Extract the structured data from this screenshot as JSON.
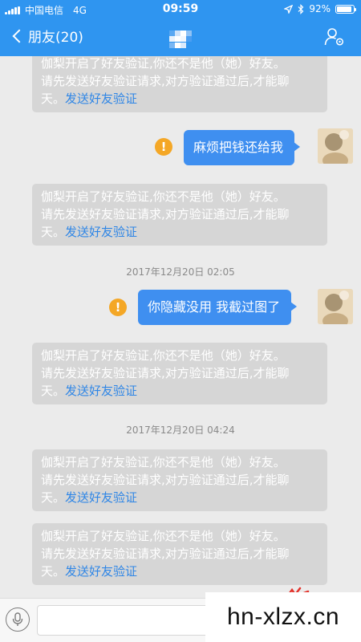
{
  "status_bar": {
    "carrier": "中国电信",
    "network": "4G",
    "time": "09:59",
    "battery": "92%",
    "battery_level": 0.92
  },
  "nav": {
    "back_label": "朋友(20)",
    "title_obscured": true,
    "profile_icon": "profile-settings-icon"
  },
  "messages": [
    {
      "type": "system",
      "text": "伽梨开启了好友验证,你还不是他（她）好友。请先发送好友验证请求,对方验证通过后,才能聊天。",
      "link": "发送好友验证"
    },
    {
      "type": "outgoing",
      "text": "麻烦把钱还给我",
      "failed": true
    },
    {
      "type": "system",
      "text": "伽梨开启了好友验证,你还不是他（她）好友。请先发送好友验证请求,对方验证通过后,才能聊天。",
      "link": "发送好友验证"
    },
    {
      "type": "timestamp",
      "text": "2017年12月20日 02:05"
    },
    {
      "type": "outgoing",
      "text": "你隐藏没用 我截过图了",
      "failed": true
    },
    {
      "type": "system",
      "text": "伽梨开启了好友验证,你还不是他（她）好友。请先发送好友验证请求,对方验证通过后,才能聊天。",
      "link": "发送好友验证"
    },
    {
      "type": "timestamp",
      "text": "2017年12月20日 04:24"
    },
    {
      "type": "system",
      "text": "伽梨开启了好友验证,你还不是他（她）好友。请先发送好友验证请求,对方验证通过后,才能聊天。",
      "link": "发送好友验证"
    },
    {
      "type": "system",
      "text": "伽梨开启了好友验证,你还不是他（她）好友。请先发送好友验证请求,对方验证通过后,才能聊天。",
      "link": "发送好友验证"
    }
  ],
  "system_lines": {
    "line1": "伽梨开启了好友验证,你还不是他（她）好友。",
    "line2": "请先发送好友验证请求,对方验证通过后,才能聊",
    "line3": "天。"
  },
  "input": {
    "placeholder": "",
    "value": ""
  },
  "watermark": "hn-xlzx.cn",
  "colors": {
    "nav_blue": "#2f95f0",
    "bubble_blue": "#3f8ff0",
    "link_blue": "#2f86e6",
    "warning": "#f4a726",
    "system_bubble": "#d6d6d6",
    "background": "#ebebeb"
  }
}
